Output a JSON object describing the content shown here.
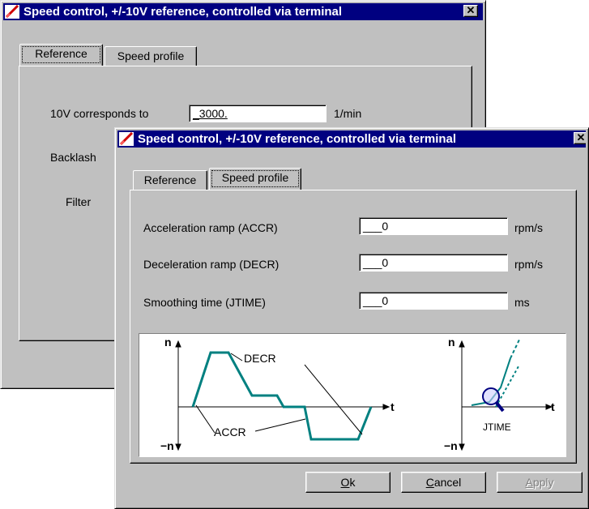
{
  "back_window": {
    "title": "Speed control, +/-10V reference, controlled via terminal",
    "close_glyph": "✕",
    "tabs": [
      "Reference",
      "Speed profile"
    ],
    "active_tab": "Reference",
    "fields": {
      "ten_v_label": "10V corresponds to",
      "ten_v_value": "_3000.",
      "ten_v_unit": "1/min",
      "backlash_label": "Backlash",
      "filter_label": "Filter"
    }
  },
  "front_window": {
    "title": "Speed control, +/-10V reference, controlled via terminal",
    "close_glyph": "✕",
    "tabs": [
      "Reference",
      "Speed profile"
    ],
    "active_tab": "Speed profile",
    "rows": [
      {
        "label": "Acceleration ramp (ACCR)",
        "value": "___0",
        "unit": "rpm/s"
      },
      {
        "label": "Deceleration ramp (DECR)",
        "value": "___0",
        "unit": "rpm/s"
      },
      {
        "label": "Smoothing time (JTIME)",
        "value": "___0",
        "unit": "ms"
      }
    ],
    "diagram": {
      "left": {
        "n_top": "n",
        "n_bottom": "−n",
        "t": "t",
        "decr": "DECR",
        "accr": "ACCR"
      },
      "right": {
        "n_top": "n",
        "n_bottom": "−n",
        "t": "t",
        "jtime": "JTIME"
      }
    },
    "buttons": {
      "ok": {
        "mnemonic": "O",
        "rest": "k"
      },
      "cancel": {
        "mnemonic": "C",
        "rest": "ancel"
      },
      "apply": {
        "mnemonic": "A",
        "rest": "pply"
      }
    }
  },
  "colors": {
    "titlebar": "#000080",
    "face": "#c0c0c0",
    "curve": "#008080"
  }
}
